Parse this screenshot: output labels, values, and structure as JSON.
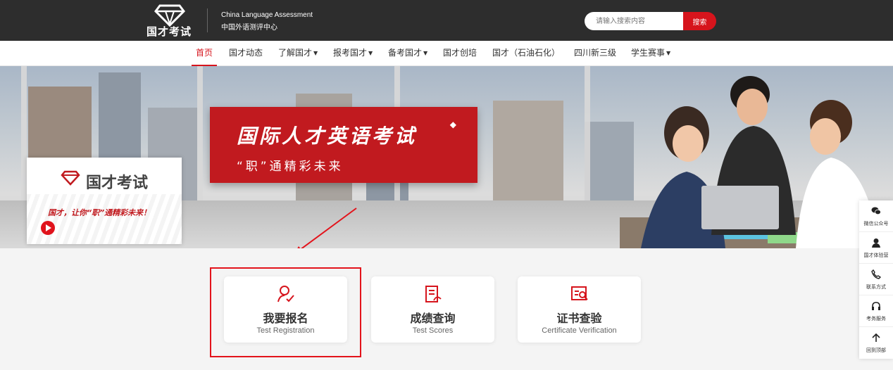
{
  "header": {
    "logo_text": "国才考试",
    "org_en": "China Language Assessment",
    "org_cn": "中国外语测评中心",
    "search": {
      "placeholder": "请输入搜索内容",
      "button": "搜索"
    }
  },
  "nav": {
    "items": [
      {
        "label": "首页",
        "active": true,
        "dropdown": false
      },
      {
        "label": "国才动态",
        "dropdown": false
      },
      {
        "label": "了解国才",
        "dropdown": true
      },
      {
        "label": "报考国才",
        "dropdown": true
      },
      {
        "label": "备考国才",
        "dropdown": true
      },
      {
        "label": "国才创培",
        "dropdown": false
      },
      {
        "label": "国才（石油石化）",
        "dropdown": false
      },
      {
        "label": "四川新三级",
        "dropdown": false
      },
      {
        "label": "学生赛事",
        "dropdown": true
      }
    ],
    "caret": "▼"
  },
  "banner": {
    "title": "国际人才英语考试",
    "subtitle": "“职”通精彩未来",
    "video_logo_text": "国才考试",
    "video_slogan": "国才，让你“职”通精彩未来！"
  },
  "cards": [
    {
      "title": "我要报名",
      "subtitle": "Test Registration",
      "icon": "user-check-icon"
    },
    {
      "title": "成绩查询",
      "subtitle": "Test Scores",
      "icon": "score-sheet-icon"
    },
    {
      "title": "证书查验",
      "subtitle": "Certificate Verification",
      "icon": "certificate-search-icon"
    }
  ],
  "sidebar": [
    {
      "label": "微信公众号",
      "icon": "wechat-icon"
    },
    {
      "label": "国才体验营",
      "icon": "person-icon"
    },
    {
      "label": "联系方式",
      "icon": "phone-icon"
    },
    {
      "label": "考务服务",
      "icon": "headset-icon"
    },
    {
      "label": "回到顶部",
      "icon": "arrow-up-icon"
    }
  ],
  "colors": {
    "brand_red": "#d6141c",
    "header_bg": "#2d2d2d"
  }
}
